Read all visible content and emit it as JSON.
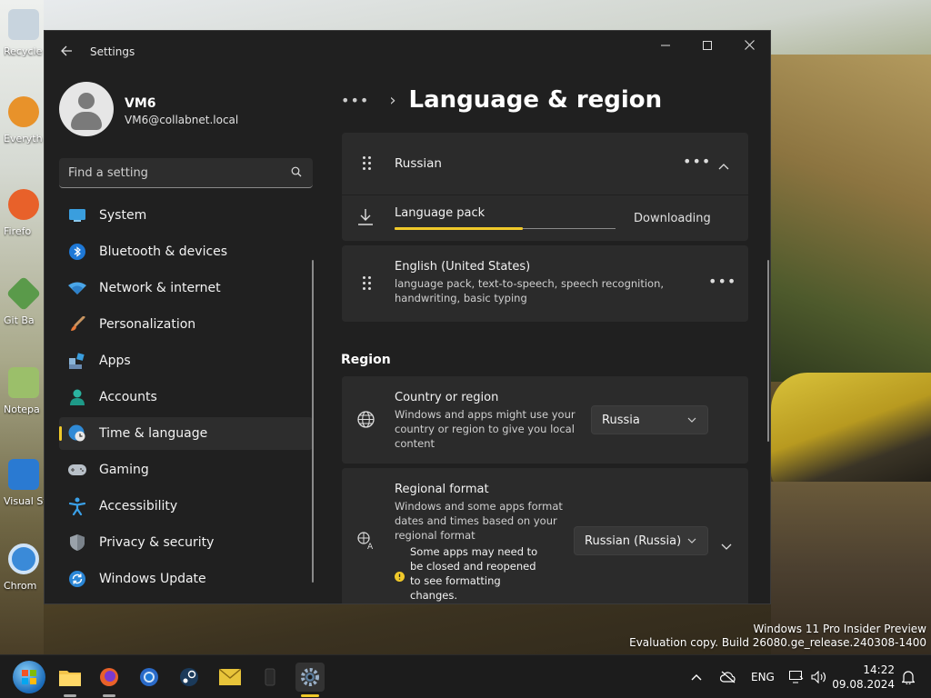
{
  "window": {
    "app_title": "Settings",
    "controls": {
      "minimize": "—",
      "maximize": "☐",
      "close": "✕"
    }
  },
  "profile": {
    "name": "VM6",
    "email": "VM6@collabnet.local"
  },
  "search": {
    "placeholder": "Find a setting"
  },
  "sidebar": {
    "items": [
      {
        "label": "System",
        "icon": "monitor-icon",
        "active": false
      },
      {
        "label": "Bluetooth & devices",
        "icon": "bluetooth-icon",
        "active": false
      },
      {
        "label": "Network & internet",
        "icon": "wifi-icon",
        "active": false
      },
      {
        "label": "Personalization",
        "icon": "brush-icon",
        "active": false
      },
      {
        "label": "Apps",
        "icon": "apps-icon",
        "active": false
      },
      {
        "label": "Accounts",
        "icon": "person-icon",
        "active": false
      },
      {
        "label": "Time & language",
        "icon": "globe-clock-icon",
        "active": true
      },
      {
        "label": "Gaming",
        "icon": "gamepad-icon",
        "active": false
      },
      {
        "label": "Accessibility",
        "icon": "accessibility-icon",
        "active": false
      },
      {
        "label": "Privacy & security",
        "icon": "shield-icon",
        "active": false
      },
      {
        "label": "Windows Update",
        "icon": "refresh-icon",
        "active": false
      }
    ]
  },
  "header": {
    "more": "•••",
    "chevron": "›",
    "title": "Language & region"
  },
  "languages": {
    "russian": {
      "name": "Russian",
      "more": "•••"
    },
    "pack": {
      "label": "Language pack",
      "status": "Downloading",
      "progress": 0.58
    },
    "english": {
      "name": "English (United States)",
      "features": "language pack, text-to-speech, speech recognition, handwriting, basic typing",
      "more": "•••"
    }
  },
  "region": {
    "heading": "Region",
    "country": {
      "title": "Country or region",
      "desc": "Windows and apps might use your country or region to give you local content",
      "value": "Russia"
    },
    "format": {
      "title": "Regional format",
      "desc": "Windows and some apps format dates and times based on your regional format",
      "warning": "Some apps may need to be closed and reopened to see formatting changes.",
      "value": "Russian (Russia)"
    }
  },
  "desktop": {
    "icons": [
      "Recycle",
      "Everyth",
      "Firefo",
      "Git Ba",
      "Notepa",
      "Visual St Cod",
      "Chrom"
    ],
    "watermark_line1": "Windows 11 Pro Insider Preview",
    "watermark_line2": "Evaluation copy. Build 26080.ge_release.240308-1400"
  },
  "taskbar": {
    "lang": "ENG",
    "time": "14:22",
    "date": "09.08.2024"
  },
  "colors": {
    "accent": "#f0c92a",
    "window_bg": "#202020",
    "card_bg": "#2b2b2b"
  }
}
